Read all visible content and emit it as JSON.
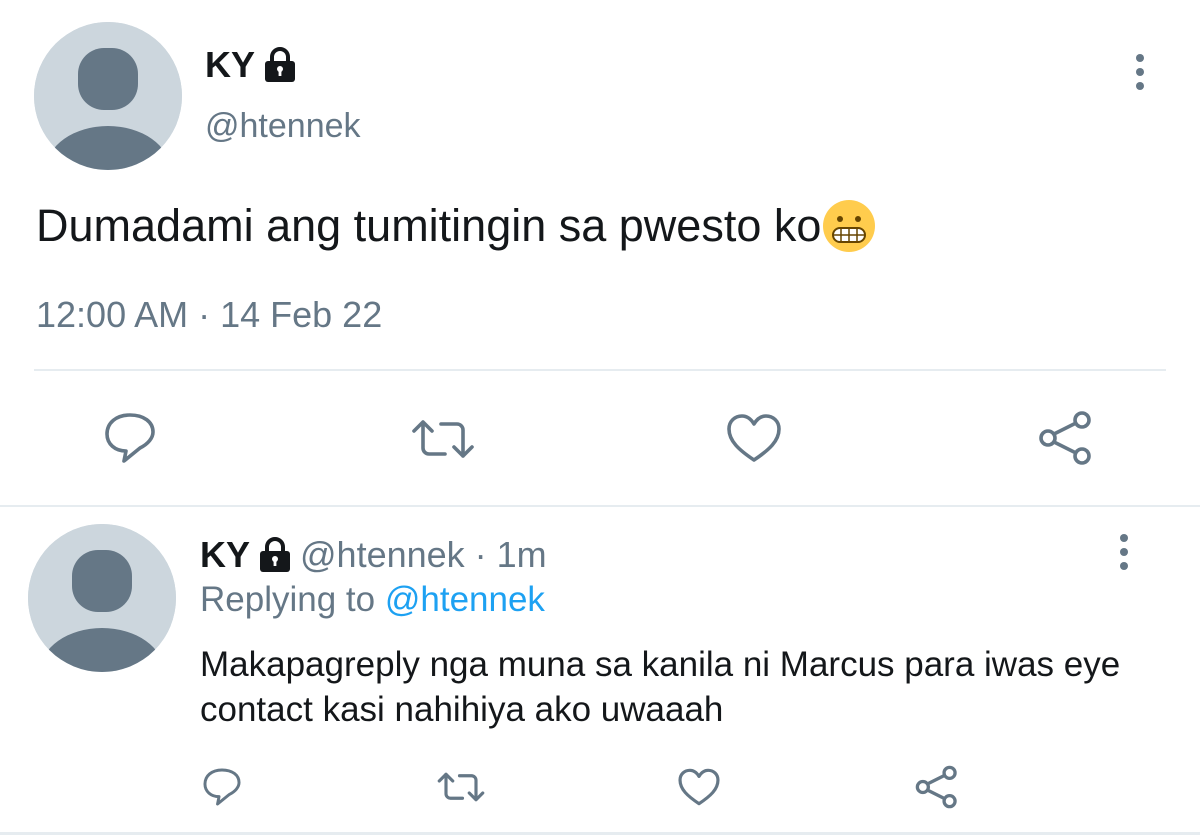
{
  "main_tweet": {
    "display_name": "KY",
    "handle": "@htennek",
    "text": "Dumadami ang tumitingin sa pwesto ko",
    "emoji": "grimacing-face",
    "timestamp": "12:00 AM · 14 Feb 22",
    "actions": [
      "reply",
      "retweet",
      "like",
      "share"
    ]
  },
  "reply_tweet": {
    "display_name": "KY",
    "handle_time": "@htennek · 1m",
    "replying_prefix": "Replying to",
    "replying_mention": "@htennek",
    "text": "Makapagreply nga muna sa kanila ni Marcus para iwas eye contact kasi nahihiya ako uwaaah",
    "actions": [
      "reply",
      "retweet",
      "like",
      "share"
    ]
  },
  "colors": {
    "text": "#14171a",
    "secondary": "#657786",
    "link": "#1da1f2",
    "avatar_bg": "#ccd6dd",
    "avatar_fg": "#657786",
    "divider": "#e6ecf0"
  }
}
